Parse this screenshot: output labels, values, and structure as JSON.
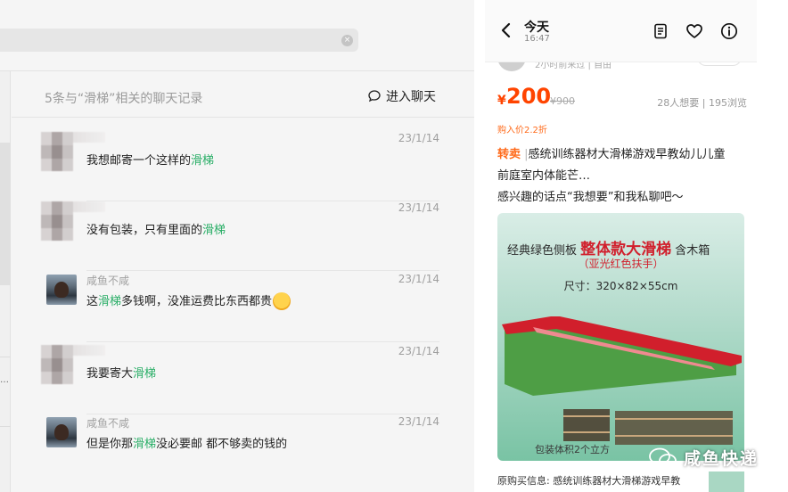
{
  "search": {
    "clear_symbol": "×"
  },
  "left_nav": {
    "dots": "…"
  },
  "results": {
    "header": "5条与“滑梯”相关的聊天记录",
    "enter_chat_label": "进入聊天",
    "messages": [
      {
        "sender": "",
        "date": "23/1/14",
        "text_before": "我想邮寄一个这样的",
        "highlight": "滑梯",
        "text_after": "",
        "avatar": "blurred",
        "emoji": false
      },
      {
        "sender": "",
        "date": "23/1/14",
        "text_before": "没有包装，只有里面的",
        "highlight": "滑梯",
        "text_after": "",
        "avatar": "blurred",
        "emoji": false
      },
      {
        "sender": "咸鱼不咸",
        "date": "23/1/14",
        "text_before": "这",
        "highlight": "滑梯",
        "text_after": "多钱啊，没准运费比东西都贵",
        "avatar": "photo",
        "emoji": true
      },
      {
        "sender": "",
        "date": "23/1/14",
        "text_before": "我要寄大",
        "highlight": "滑梯",
        "text_after": "",
        "avatar": "blurred",
        "emoji": false
      },
      {
        "sender": "咸鱼不咸",
        "date": "23/1/14",
        "text_before": "但是你那",
        "highlight": "滑梯",
        "text_after": "没必要邮  都不够卖的钱的",
        "avatar": "photo",
        "emoji": false
      }
    ]
  },
  "product_window": {
    "title": "今天",
    "time": "16:47",
    "peek_text": "2小时前来过 | 自由",
    "price_symbol": "¥",
    "price": "200",
    "original_price": "¥900",
    "stats": "28人想要 | 195浏览",
    "bought_price": "购入价2.2折",
    "tag": "转卖",
    "tag_sep": "|",
    "title_line1": "感统训练器材大滑梯游戏早教幼儿儿童",
    "title_line2": "前庭室内体能芒…",
    "title_line3": "感兴趣的话点“我想要”和我私聊吧～",
    "image": {
      "line1_a": "经典绿色侧板",
      "line1_b": "整体款大滑梯",
      "line1_c": "含木箱",
      "line2": "（亚光红色扶手）",
      "line3": "尺寸：320×82×55cm",
      "line4": "包装体积2个立方"
    },
    "original_info": "原购买信息: 感统训练器材大滑梯游戏早教"
  },
  "watermark": "咸鱼快递",
  "colors": {
    "highlight": "#2aae67",
    "price": "#ff4400",
    "tag": "#ff6a1a",
    "slide_red": "#d11f2c",
    "slide_green": "#4e9e45"
  },
  "icons": [
    "search-clear-icon",
    "chat-bubble-icon",
    "back-chevron-icon",
    "note-icon",
    "heart-icon",
    "info-icon",
    "wechat-icon"
  ]
}
